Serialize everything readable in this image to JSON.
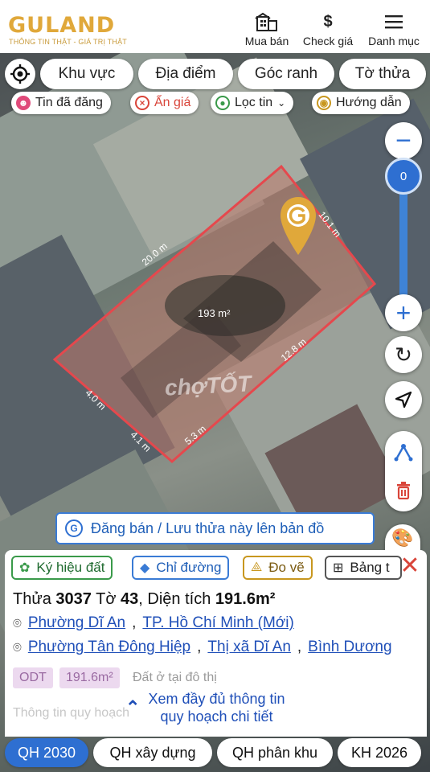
{
  "header": {
    "logo": "GULAND",
    "tagline": "THÔNG TIN THẬT - GIÁ TRỊ THẬT",
    "nav": [
      {
        "label": "Mua bán",
        "icon": "building-icon"
      },
      {
        "label": "Check giá",
        "icon": "dollar-icon"
      },
      {
        "label": "Danh mục",
        "icon": "menu-icon"
      }
    ]
  },
  "filters": {
    "primary": [
      "Khu vực",
      "Địa điểm",
      "Góc ranh",
      "Tờ thửa"
    ],
    "secondary": [
      {
        "label": "Tin đã đăng",
        "icon": "posted-icon"
      },
      {
        "label": "Ẩn giá",
        "icon": "hide-price-icon"
      },
      {
        "label": "Lọc tin",
        "icon": "filter-icon"
      },
      {
        "label": "Hướng dẫn",
        "icon": "guide-icon"
      }
    ]
  },
  "map": {
    "area_label": "193 m²",
    "edges": [
      "20.0 m",
      "10.1 m",
      "12.8 m",
      "5.3 m",
      "4.1 m",
      "4.0 m"
    ],
    "watermark": "chợTỐT",
    "zoom_level": "0"
  },
  "banner": {
    "text": "Đăng bán / Lưu thửa này lên bản đồ"
  },
  "panel": {
    "tools": [
      "Ký hiệu đất",
      "Chỉ đường",
      "Đo vẽ",
      "Bảng t"
    ],
    "title": {
      "prefix": "Thửa",
      "parcel": "3037",
      "sheet_prefix": "Tờ",
      "sheet": "43",
      "area_prefix": "Diện tích",
      "area": "191.6m²"
    },
    "address_new": {
      "ward": "Phường Dĩ An",
      "city": "TP. Hồ Chí Minh (Mới)"
    },
    "address_old": {
      "ward": "Phường Tân Đông Hiệp",
      "town": "Thị xã Dĩ An",
      "province": "Bình Dương"
    },
    "land_code": "ODT",
    "land_area": "191.6m²",
    "land_desc": "Đất ở tại đô thị",
    "faded_text": "Thông tin quy hoạch",
    "more_line1": "Xem đầy đủ thông tin",
    "more_line2": "quy hoạch chi tiết"
  },
  "tabs": [
    "QH 2030",
    "QH xây dựng",
    "QH phân khu",
    "KH 2026"
  ],
  "colors": {
    "accent": "#2e6fd1",
    "brand": "#e0a83a",
    "danger": "#d9453a",
    "parcel_border": "#e5484d"
  }
}
